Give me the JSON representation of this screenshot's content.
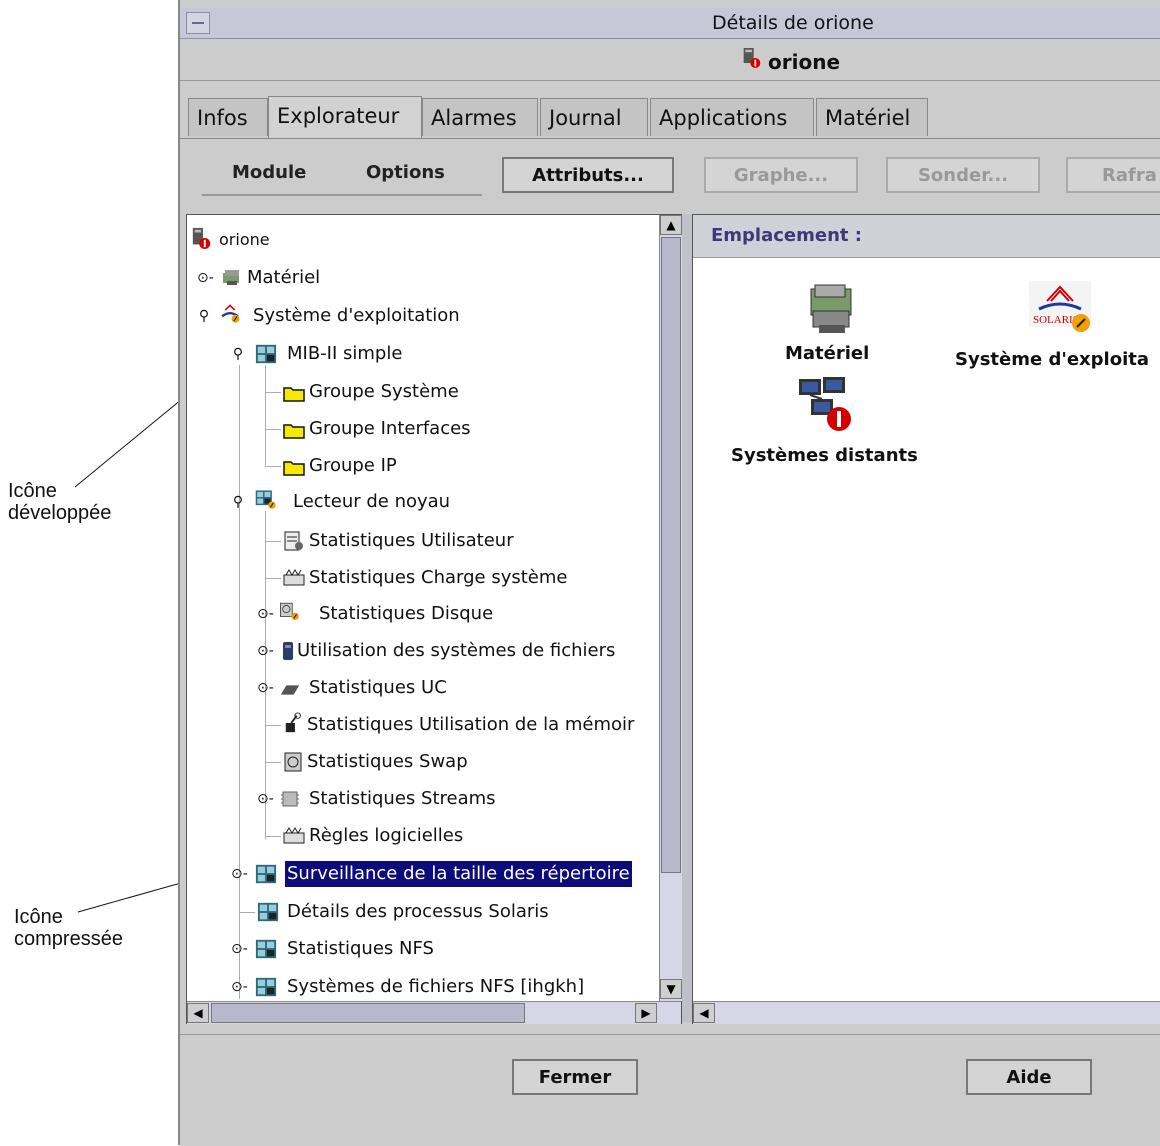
{
  "window": {
    "title": "Détails de orione",
    "host": "orione"
  },
  "tabs": [
    "Infos",
    "Explorateur",
    "Alarmes",
    "Journal",
    "Applications",
    "Matériel"
  ],
  "toolbar": {
    "menus": [
      "Module",
      "Options"
    ],
    "buttons": [
      "Attributs...",
      "Graphe...",
      "Sonder...",
      "Rafra"
    ]
  },
  "tree": {
    "items": [
      "orione",
      "Matériel",
      "Système d'exploitation",
      "MIB-II simple",
      "Groupe Système",
      "Groupe Interfaces",
      "Groupe IP",
      "Lecteur de noyau",
      "Statistiques Utilisateur",
      "Statistiques Charge système",
      "Statistiques Disque",
      "Utilisation des systèmes de fichiers",
      "Statistiques UC",
      "Statistiques Utilisation de la mémoir",
      "Statistiques Swap",
      "Statistiques Streams",
      "Règles logicielles",
      "Surveillance de la taille des répertoire",
      "Détails des processus Solaris",
      "Statistiques NFS",
      "Systèmes de fichiers NFS [ihgkh]"
    ]
  },
  "right_pane": {
    "location_label": "Emplacement :",
    "icons": [
      "Matériel",
      "Système d'exploita",
      "Systèmes distants"
    ],
    "solaris_text": "SOLARIS"
  },
  "footer": {
    "close": "Fermer",
    "help": "Aide"
  },
  "annotations": {
    "expanded_line1": "Icône",
    "expanded_line2": "développée",
    "collapsed_line1": "Icône",
    "collapsed_line2": "compressée"
  },
  "colors": {
    "selection": "#0b0b7a",
    "titlebar": "#c6c8d8",
    "panel": "#cccccc",
    "alarm_red": "#d40000",
    "folder_yellow": "#f6e800"
  }
}
